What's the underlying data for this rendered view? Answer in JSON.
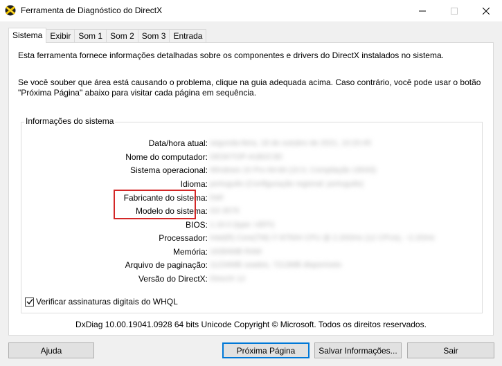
{
  "window": {
    "title": "Ferramenta de Diagnóstico do DirectX"
  },
  "tabs": [
    {
      "label": "Sistema",
      "active": true
    },
    {
      "label": "Exibir",
      "active": false
    },
    {
      "label": "Som 1",
      "active": false
    },
    {
      "label": "Som 2",
      "active": false
    },
    {
      "label": "Som 3",
      "active": false
    },
    {
      "label": "Entrada",
      "active": false
    }
  ],
  "intro": {
    "line1": "Esta ferramenta fornece informações detalhadas sobre os componentes e drivers do DirectX instalados no sistema.",
    "line2": "Se você souber que área está causando o problema, clique na guia adequada acima. Caso contrário, você pode usar o botão \"Próxima Página\" abaixo para visitar cada página em sequência."
  },
  "system_info": {
    "legend": "Informações do sistema",
    "rows": [
      {
        "label": "Data/hora atual:",
        "value": "segunda-feira, 18 de outubro de 2021, 10:20:45"
      },
      {
        "label": "Nome do computador:",
        "value": "DESKTOP-A1B2C3D"
      },
      {
        "label": "Sistema operacional:",
        "value": "Windows 10 Pro 64-bit (10.0, Compilação 19043)"
      },
      {
        "label": "Idioma:",
        "value": "português (Configuração regional: português)"
      },
      {
        "label": "Fabricante do sistema:",
        "value": "Dell"
      },
      {
        "label": "Modelo do sistema:",
        "value": "G3 3579"
      },
      {
        "label": "BIOS:",
        "value": "1.16.0 (type: UEFI)"
      },
      {
        "label": "Processador:",
        "value": "Intel(R) Core(TM) i7-8750H CPU @ 2.20GHz (12 CPUs), ~2.2GHz"
      },
      {
        "label": "Memória:",
        "value": "16384MB RAM"
      },
      {
        "label": "Arquivo de paginação:",
        "value": "11234MB usados, 7213MB disponíveis"
      },
      {
        "label": "Versão do DirectX:",
        "value": "DirectX 12"
      }
    ]
  },
  "whql": {
    "label": "Verificar assinaturas digitais do WHQL",
    "checked": true
  },
  "footer_note": "DxDiag 10.00.19041.0928 64 bits Unicode  Copyright © Microsoft. Todos os direitos reservados.",
  "buttons": {
    "help": "Ajuda",
    "next_page": "Próxima Página",
    "save_info": "Salvar Informações...",
    "exit": "Sair"
  },
  "icons": {
    "app": "directx-icon",
    "minimize": "minimize-icon",
    "maximize": "maximize-icon",
    "close": "close-icon",
    "checkbox": "check-icon"
  },
  "colors": {
    "highlight_border": "#d32727",
    "default_button_border": "#0078d7"
  }
}
